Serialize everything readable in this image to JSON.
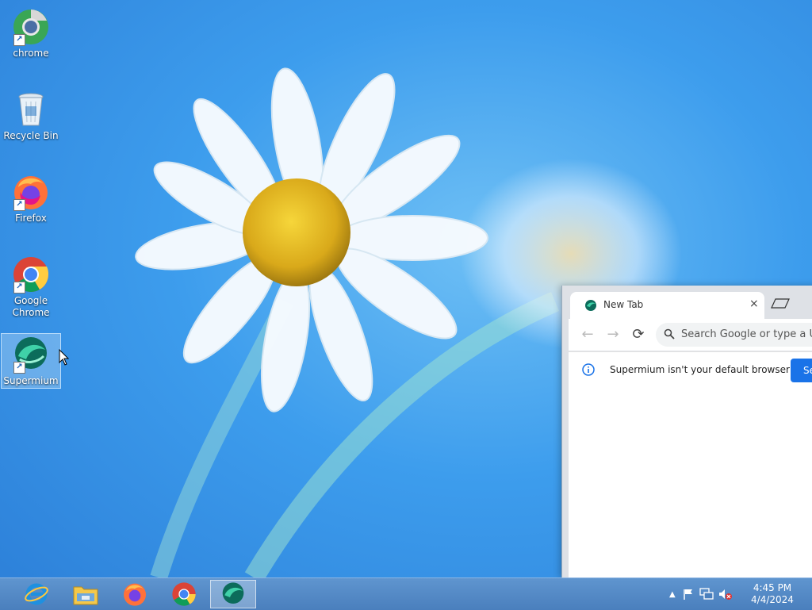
{
  "desktop": {
    "icons": [
      {
        "label": "chrome",
        "icon": "chrome-canary-shortcut-icon"
      },
      {
        "label": "Recycle Bin",
        "icon": "recycle-bin-icon"
      },
      {
        "label": "Firefox",
        "icon": "firefox-icon"
      },
      {
        "label": "Google Chrome",
        "icon": "google-chrome-icon"
      },
      {
        "label": "Supermium",
        "icon": "supermium-icon",
        "selected": true
      }
    ]
  },
  "browser": {
    "tab_title": "New Tab",
    "tab_close": "×",
    "omnibox_placeholder": "Search Google or type a URL",
    "infobar_text": "Supermium isn't your default browser",
    "infobar_button": "Set as default"
  },
  "taskbar": {
    "pinned": [
      "internet-explorer-icon",
      "file-explorer-icon",
      "firefox-icon",
      "google-chrome-icon",
      "supermium-icon"
    ],
    "active_app": "Supermium",
    "clock_time": "4:45 PM",
    "clock_date": "4/4/2024"
  },
  "colors": {
    "accent": "#1a73e8",
    "taskbar": "#5a8ecb",
    "desktop": "#3d9ded"
  }
}
